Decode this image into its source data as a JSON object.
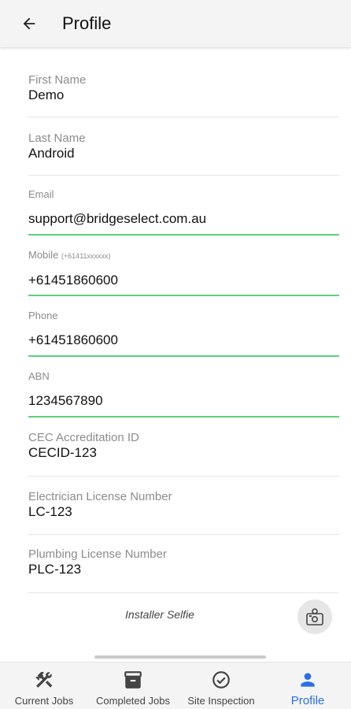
{
  "header": {
    "title": "Profile",
    "back_icon": "arrow-left-icon"
  },
  "fields": {
    "first_name": {
      "label": "First Name",
      "value": "Demo"
    },
    "last_name": {
      "label": "Last Name",
      "value": "Android"
    },
    "email": {
      "label": "Email",
      "value": "support@bridgeselect.com.au"
    },
    "mobile": {
      "label": "Mobile",
      "hint": "(+61411xxxxxx)",
      "value": "+61451860600"
    },
    "phone": {
      "label": "Phone",
      "value": "+61451860600"
    },
    "abn": {
      "label": "ABN",
      "value": "1234567890"
    },
    "cec": {
      "label": "CEC Accreditation ID",
      "value": "CECID-123"
    },
    "electrician": {
      "label": "Electrician License Number",
      "value": "LC-123"
    },
    "plumbing": {
      "label": "Plumbing License Number",
      "value": "PLC-123"
    }
  },
  "selfie": {
    "label": "Installer Selfie",
    "icon": "camera-person-icon"
  },
  "nav": {
    "items": [
      {
        "label": "Current Jobs",
        "icon": "tools-icon"
      },
      {
        "label": "Completed Jobs",
        "icon": "archive-box-icon"
      },
      {
        "label": "Site Inspection",
        "icon": "check-circle-icon"
      },
      {
        "label": "Profile",
        "icon": "person-icon"
      }
    ],
    "active_index": 3
  },
  "colors": {
    "accent": "#2a6fe6",
    "input_underline": "#5ccf7e"
  }
}
